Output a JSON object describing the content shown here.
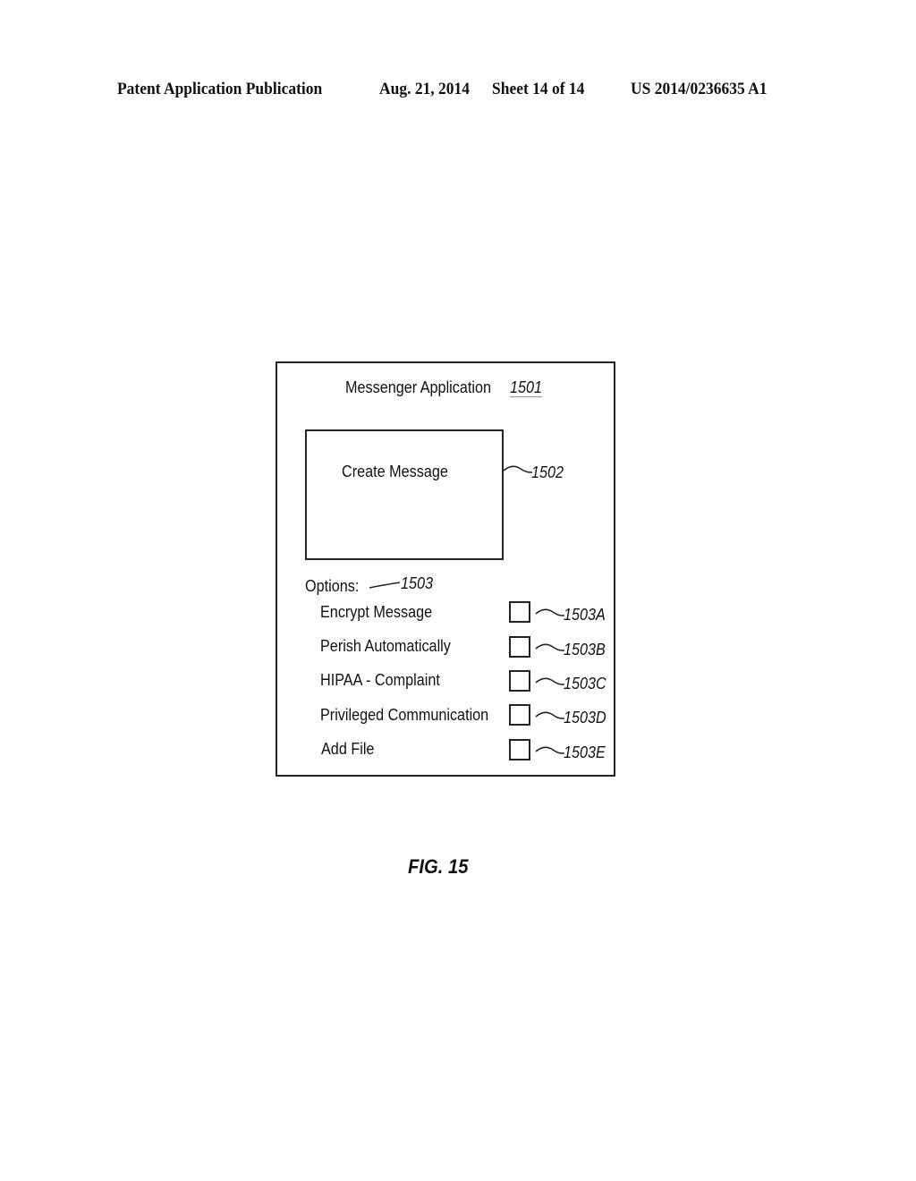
{
  "header": {
    "publication": "Patent Application Publication",
    "date": "Aug. 21, 2014",
    "sheet": "Sheet 14 of 14",
    "number": "US 2014/0236635 A1"
  },
  "figure": {
    "app_title": "Messenger Application",
    "app_ref": "1501",
    "create_message_label": "Create Message",
    "create_message_ref": "1502",
    "options_label": "Options:",
    "options_ref": "1503",
    "options": [
      {
        "label": "Encrypt Message",
        "ref": "1503A",
        "checked": false
      },
      {
        "label": "Perish Automatically",
        "ref": "1503B",
        "checked": false
      },
      {
        "label": "HIPAA - Complaint",
        "ref": "1503C",
        "checked": false
      },
      {
        "label": "Privileged Communication",
        "ref": "1503D",
        "checked": false
      },
      {
        "label": "Add File",
        "ref": "1503E",
        "checked": false
      }
    ],
    "caption": "FIG. 15"
  }
}
